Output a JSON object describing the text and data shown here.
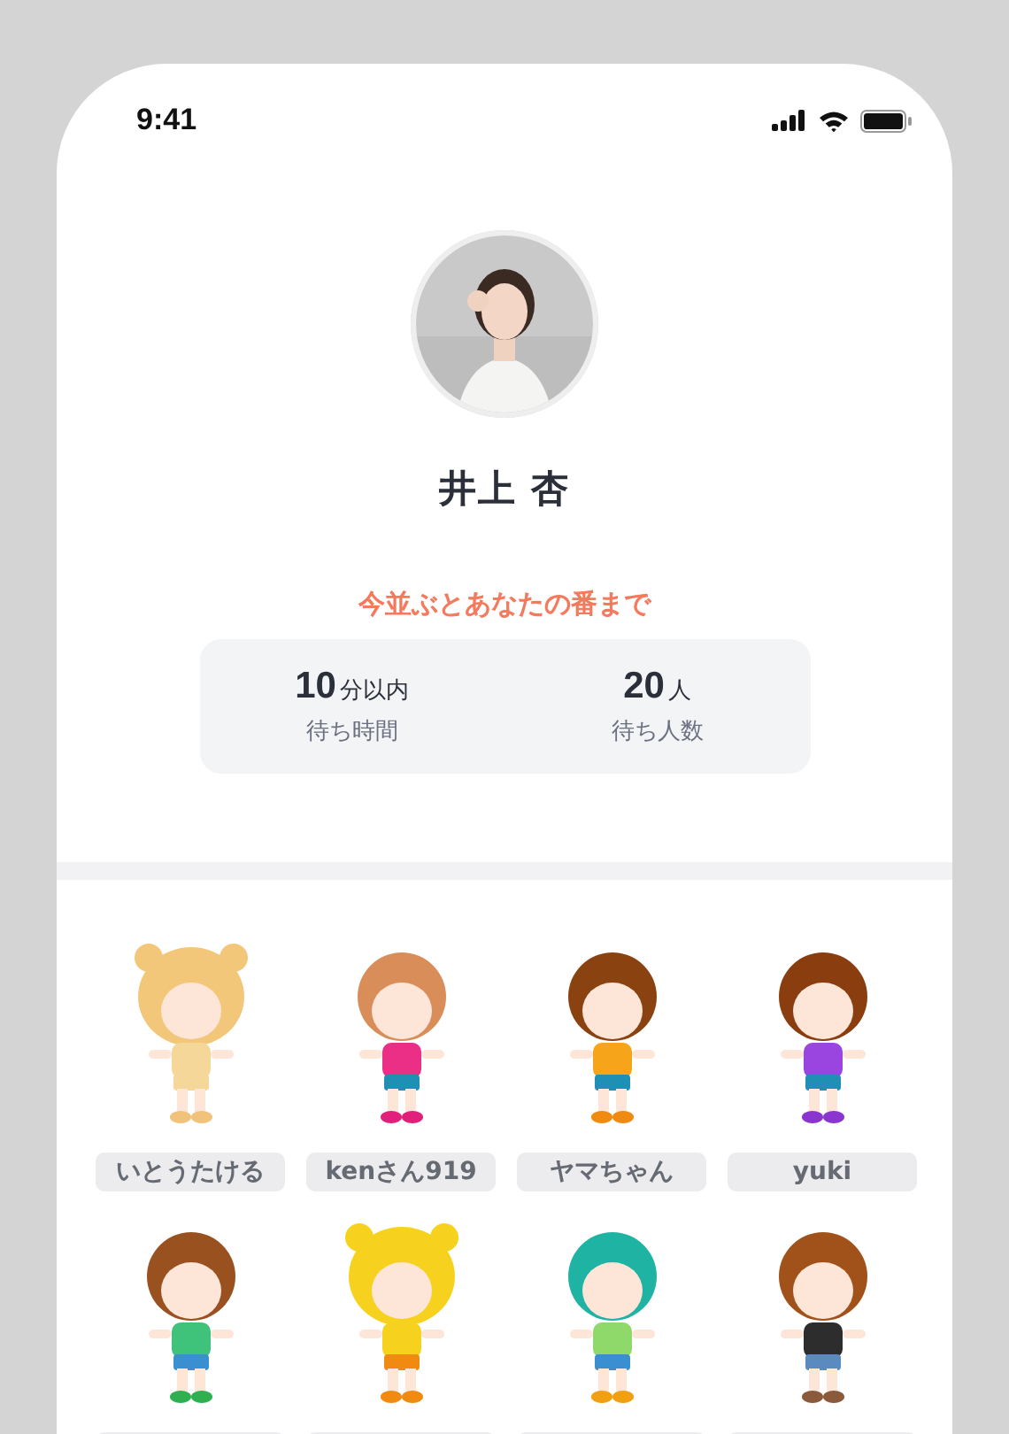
{
  "status_bar": {
    "time": "9:41"
  },
  "profile": {
    "photo": {
      "kind": "picture"
    },
    "name": "井上 杏"
  },
  "queue": {
    "heading": "今並ぶとあなたの番まで",
    "stats": [
      {
        "value": "10",
        "unit": "分以内",
        "label": "待ち時間"
      },
      {
        "value": "20",
        "unit": "人",
        "label": "待ち人数"
      }
    ]
  },
  "users": [
    {
      "kind": "picture",
      "name": "いとうたける"
    },
    {
      "kind": "picture",
      "name": "kenさん919"
    },
    {
      "kind": "picture",
      "name": "ヤマちゃん"
    },
    {
      "kind": "picture",
      "name": "yuki"
    },
    {
      "kind": "picture"
    },
    {
      "kind": "picture"
    },
    {
      "kind": "picture"
    },
    {
      "kind": "picture"
    }
  ]
}
